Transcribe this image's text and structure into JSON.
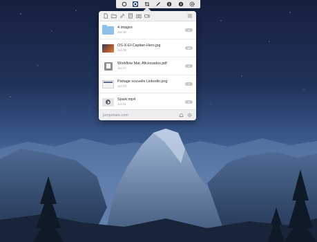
{
  "menubar": {
    "icons": [
      "circle-icon",
      "jumpshare-icon",
      "crop-screenshot-icon",
      "pen-icon",
      "info-icon",
      "bolt-icon",
      "settings-icon"
    ]
  },
  "toolbar": {
    "icons": [
      "new-file-icon",
      "folder-icon",
      "link-icon",
      "note-icon",
      "camera-icon",
      "video-icon",
      "menu-icon"
    ]
  },
  "files": [
    {
      "name": "4 images",
      "date": "Jun 30",
      "count": "4",
      "thumb": "folder"
    },
    {
      "name": "OS-X-El-Capitan-Hero.jpg",
      "date": "Jun 08",
      "count": "13",
      "thumb": "photo"
    },
    {
      "name": "Workflow Mac Aficionados.pdf",
      "date": "Jun 07",
      "count": "4",
      "thumb": "pdf"
    },
    {
      "name": "Partage nouvelle Linkedin.png",
      "date": "Jun 03",
      "count": "1",
      "thumb": "screenshot"
    },
    {
      "name": "Spark.mp4",
      "date": "Jun 01",
      "count": "0",
      "thumb": "video"
    }
  ],
  "footer": {
    "brand": "jumpshare.com",
    "icons": [
      "bell-icon",
      "gear-icon"
    ]
  },
  "colors": {
    "popover_bg": "#f5f5f6",
    "badge": "#c6c8cc",
    "folder": "#8ec1ea",
    "sky": "#21325a"
  }
}
